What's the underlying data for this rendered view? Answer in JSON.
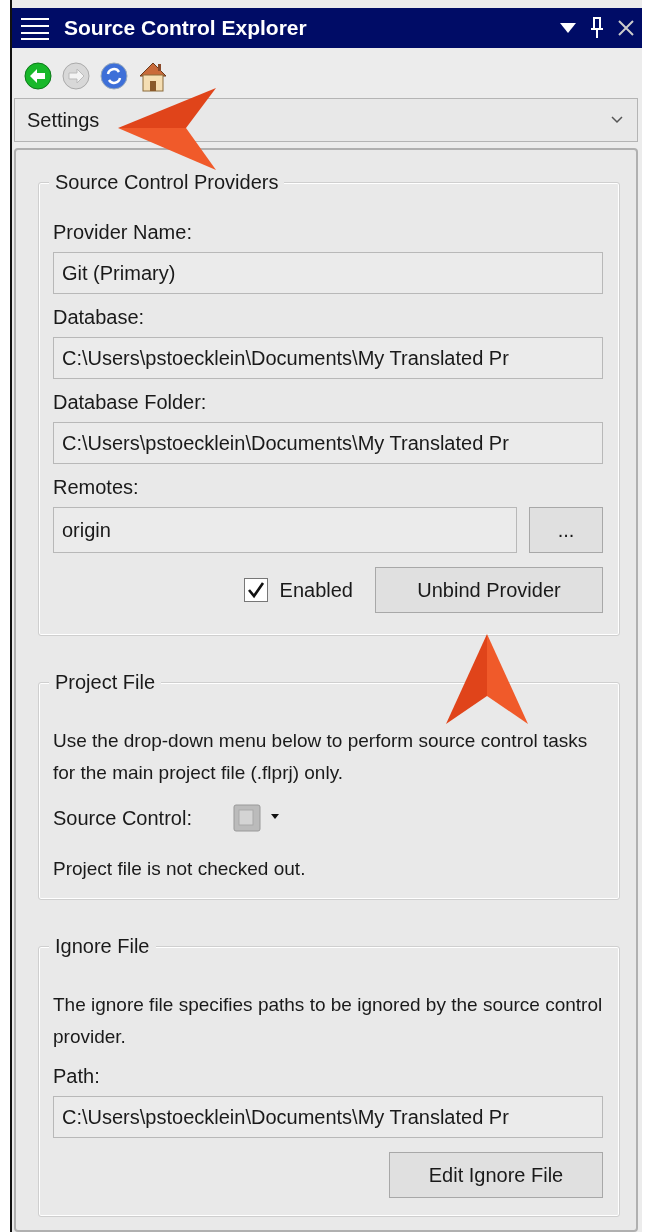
{
  "window": {
    "title": "Source Control Explorer"
  },
  "view_selector": {
    "value": "Settings"
  },
  "providers_group": {
    "legend": "Source Control Providers",
    "fields": [
      {
        "label": "Provider Name:",
        "value": "Git (Primary)"
      },
      {
        "label": "Database:",
        "value": "C:\\Users\\pstoecklein\\Documents\\My Translated Pr"
      },
      {
        "label": "Database Folder:",
        "value": "C:\\Users\\pstoecklein\\Documents\\My Translated Pr"
      }
    ],
    "remotes": {
      "label": "Remotes:",
      "value": "origin",
      "browse_button": "..."
    },
    "enabled": {
      "label": "Enabled",
      "checked": true
    },
    "unbind_button": "Unbind Provider"
  },
  "project_file_group": {
    "legend": "Project File",
    "description": "Use the drop-down menu below to perform source control tasks for the main project file (.flprj) only.",
    "source_control_label": "Source Control:",
    "status": "Project file is not checked out."
  },
  "ignore_file_group": {
    "legend": "Ignore File",
    "description": "The ignore file specifies paths to be ignored by the source control provider.",
    "path_label": "Path:",
    "path_value": "C:\\Users\\pstoecklein\\Documents\\My Translated Pr",
    "edit_button": "Edit Ignore File"
  }
}
